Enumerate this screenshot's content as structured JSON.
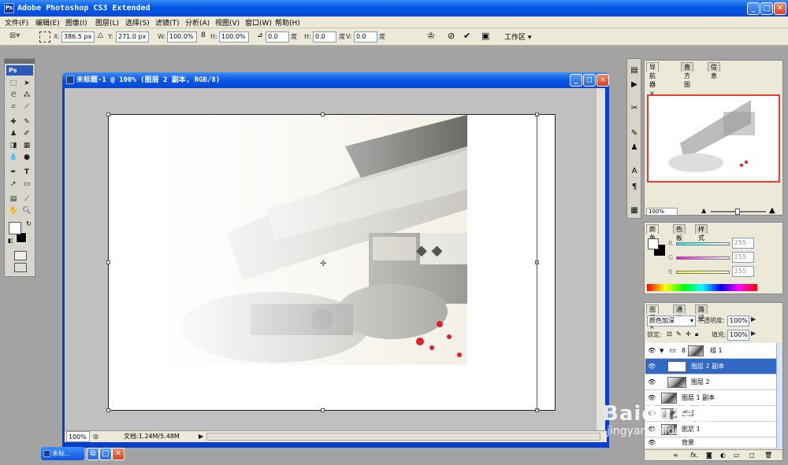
{
  "app": {
    "title": "Adobe Photoshop CS3 Extended",
    "logo": "Ps"
  },
  "menu": [
    "文件(F)",
    "编辑(E)",
    "图像(I)",
    "图层(L)",
    "选择(S)",
    "滤镜(T)",
    "分析(A)",
    "视图(V)",
    "窗口(W)",
    "帮助(H)"
  ],
  "options": {
    "x_label": "X:",
    "x": "386.5 px",
    "y_label": "Y:",
    "y": "271.0 px",
    "w_label": "W:",
    "w": "100.0%",
    "h_label": "H:",
    "h": "100.0%",
    "angle": "0.0",
    "angle_unit": "度",
    "hskew_label": "H:",
    "hskew": "0.0",
    "hskew_unit": "度",
    "vskew_label": "V:",
    "vskew": "0.0",
    "vskew_unit": "度",
    "workspace": "工作区"
  },
  "document": {
    "title": "未标题-1 @ 100% (图层 2 副本, RGB/8)",
    "zoom": "100%",
    "doc_info": "文档:1.24M/5.48M"
  },
  "navigator": {
    "tabs": [
      "导航器",
      "直方图",
      "信息"
    ],
    "zoom": "100%"
  },
  "color": {
    "tabs": [
      "颜色",
      "色板",
      "样式"
    ],
    "r_label": "R",
    "g_label": "G",
    "b_label": "B",
    "r": "255",
    "g": "255",
    "b": "255"
  },
  "layers": {
    "tabs": [
      "图层",
      "通道",
      "路径"
    ],
    "blend_mode": "颜色加深",
    "opacity_label": "不透明度:",
    "opacity": "100%",
    "lock_label": "锁定:",
    "fill_label": "填充:",
    "fill": "100%",
    "items": [
      {
        "name": "组 1"
      },
      {
        "name": "图层 2 副本"
      },
      {
        "name": "图层 2"
      },
      {
        "name": "图层 1 副本"
      },
      {
        "name": "图层"
      },
      {
        "name": "图层 1"
      },
      {
        "name": "背景"
      }
    ]
  },
  "taskbar": {
    "label": "未标..."
  },
  "watermark": {
    "text": "Baidu经验",
    "sub": "jingyan.baidu.com"
  },
  "colors": {
    "xp_blue": "#0a55e4",
    "panel_bg": "#ece9d8",
    "selection": "#316ac5",
    "navigator_frame": "#e0403a"
  }
}
